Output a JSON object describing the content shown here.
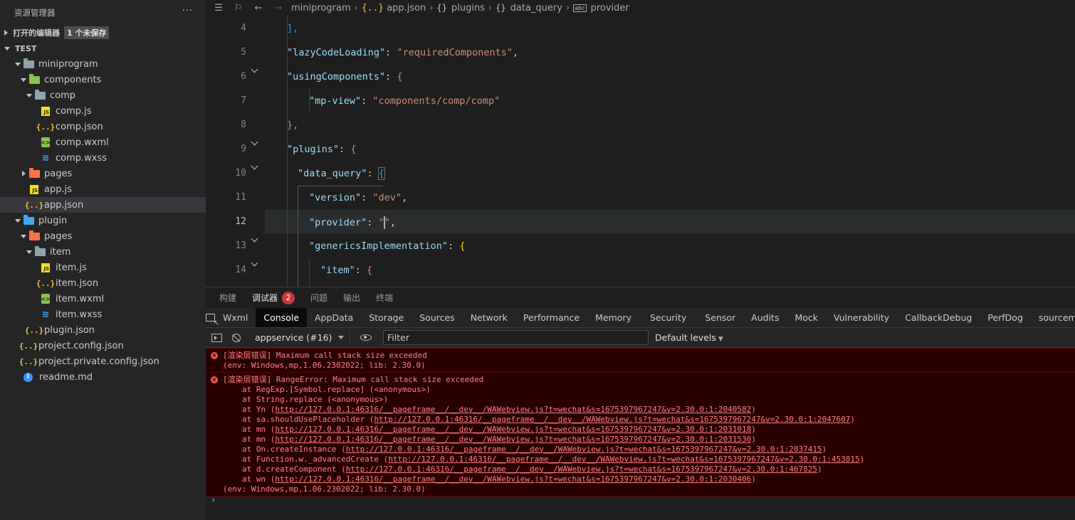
{
  "sidebar": {
    "title": "资源管理器",
    "more": "···",
    "open_editors": {
      "label": "打开的编辑器",
      "badge": "1 个未保存"
    },
    "workspace": "TEST",
    "tree": [
      {
        "label": "miniprogram",
        "depth": 0,
        "type": "folder",
        "icon": "folder-icon",
        "color": "gray",
        "open": true
      },
      {
        "label": "components",
        "depth": 1,
        "type": "folder",
        "icon": "components-folder-icon",
        "color": "green",
        "open": true
      },
      {
        "label": "comp",
        "depth": 2,
        "type": "folder",
        "icon": "folder-icon",
        "color": "gray",
        "open": true
      },
      {
        "label": "comp.js",
        "depth": 3,
        "type": "js"
      },
      {
        "label": "comp.json",
        "depth": 3,
        "type": "json"
      },
      {
        "label": "comp.wxml",
        "depth": 3,
        "type": "wxml"
      },
      {
        "label": "comp.wxss",
        "depth": 3,
        "type": "wxss"
      },
      {
        "label": "pages",
        "depth": 1,
        "type": "folder",
        "icon": "pages-folder-icon",
        "color": "orange",
        "open": false
      },
      {
        "label": "app.js",
        "depth": 1,
        "type": "js"
      },
      {
        "label": "app.json",
        "depth": 1,
        "type": "json",
        "selected": true
      },
      {
        "label": "plugin",
        "depth": 0,
        "type": "folder",
        "icon": "plugin-folder-icon",
        "color": "blue",
        "open": true
      },
      {
        "label": "pages",
        "depth": 1,
        "type": "folder",
        "icon": "pages-folder-icon",
        "color": "orange",
        "open": true
      },
      {
        "label": "item",
        "depth": 2,
        "type": "folder",
        "icon": "folder-icon",
        "color": "gray",
        "open": true
      },
      {
        "label": "item.js",
        "depth": 3,
        "type": "js"
      },
      {
        "label": "item.json",
        "depth": 3,
        "type": "json"
      },
      {
        "label": "item.wxml",
        "depth": 3,
        "type": "wxml"
      },
      {
        "label": "item.wxss",
        "depth": 3,
        "type": "wxss"
      },
      {
        "label": "plugin.json",
        "depth": 1,
        "type": "json"
      },
      {
        "label": "project.config.json",
        "depth": 0,
        "type": "json"
      },
      {
        "label": "project.private.config.json",
        "depth": 0,
        "type": "json"
      },
      {
        "label": "readme.md",
        "depth": 0,
        "type": "md"
      }
    ]
  },
  "editor": {
    "breadcrumb": {
      "folder": "miniprogram",
      "file_icon": "{..}",
      "file": "app.json",
      "obj_icon": "{}",
      "items": [
        "plugins",
        "data_query"
      ],
      "leaf_icon": "abc",
      "leaf": "provider"
    },
    "line_numbers": [
      "4",
      "5",
      "6",
      "7",
      "8",
      "9",
      "10",
      "11",
      "12",
      "13",
      "14"
    ],
    "current_line": "12",
    "code": {
      "l4": "],",
      "l5_key": "\"lazyCodeLoading\"",
      "l5_val": "\"requiredComponents\"",
      "l6_key": "\"usingComponents\"",
      "l7_key": "\"mp-view\"",
      "l7_val": "\"components/comp/comp\"",
      "l8": "},",
      "l9_key": "\"plugins\"",
      "l10_key": "\"data_query\"",
      "l11_key": "\"version\"",
      "l11_val": "\"dev\"",
      "l12_key": "\"provider\"",
      "l12_val_open": "\"",
      "l12_val_close": "\"",
      "l13_key": "\"genericsImplementation\"",
      "l14_key": "\"item\""
    }
  },
  "panel": {
    "tabs": [
      {
        "label": "构建",
        "active": false
      },
      {
        "label": "调试器",
        "active": true,
        "badge": "2"
      },
      {
        "label": "问题",
        "active": false
      },
      {
        "label": "输出",
        "active": false
      },
      {
        "label": "终端",
        "active": false
      }
    ],
    "devtools_tabs": [
      "Wxml",
      "Console",
      "AppData",
      "Storage",
      "Sources",
      "Network",
      "Performance",
      "Memory",
      "Security",
      "Sensor",
      "Audits",
      "Mock",
      "Vulnerability",
      "CallbackDebug",
      "PerfDog",
      "sourcemap"
    ],
    "devtools_active": "Console",
    "context": "appservice (#16)",
    "filter_placeholder": "Filter",
    "levels": "Default levels",
    "messages": [
      {
        "lines": [
          "[渲染层错误] Maximum call stack size exceeded",
          "(env: Windows,mp,1.06.2302022; lib: 2.30.0)"
        ]
      },
      {
        "title": "[渲染层错误] RangeError: Maximum call stack size exceeded",
        "stack": [
          {
            "pre": "at RegExp.[Symbol.replace] (<anonymous>)",
            "url": "",
            "post": ""
          },
          {
            "pre": "at String.replace (<anonymous>)",
            "url": "",
            "post": ""
          },
          {
            "pre": "at Yn (",
            "url": "http://127.0.0.1:46316/__pageframe__/__dev__/WAWebview.js?t=wechat&s=1675397967247&v=2.30.0:1:2040582",
            "post": ")"
          },
          {
            "pre": "at sa.shouldUsePlaceholder (",
            "url": "http://127.0.0.1:46316/__pageframe__/__dev__/WAWebview.js?t=wechat&s=1675397967247&v=2.30.0:1:2047607",
            "post": ")"
          },
          {
            "pre": "at mn (",
            "url": "http://127.0.0.1:46316/__pageframe__/__dev__/WAWebview.js?t=wechat&s=1675397967247&v=2.30.0:1:2031018",
            "post": ")"
          },
          {
            "pre": "at mn (",
            "url": "http://127.0.0.1:46316/__pageframe__/__dev__/WAWebview.js?t=wechat&s=1675397967247&v=2.30.0:1:2031530",
            "post": ")"
          },
          {
            "pre": "at On.createInstance (",
            "url": "http://127.0.0.1:46316/__pageframe__/__dev__/WAWebview.js?t=wechat&s=1675397967247&v=2.30.0:1:2037415",
            "post": ")"
          },
          {
            "pre": "at Function.w._advancedCreate (",
            "url": "http://127.0.0.1:46316/__pageframe__/__dev__/WAWebview.js?t=wechat&s=1675397967247&v=2.30.0:1:453815",
            "post": ")"
          },
          {
            "pre": "at d.createComponent (",
            "url": "http://127.0.0.1:46316/__pageframe__/__dev__/WAWebview.js?t=wechat&s=1675397967247&v=2.30.0:1:467825",
            "post": ")"
          },
          {
            "pre": "at wn (",
            "url": "http://127.0.0.1:46316/__pageframe__/__dev__/WAWebview.js?t=wechat&s=1675397967247&v=2.30.0:1:2030406",
            "post": ")"
          }
        ],
        "env": "(env: Windows,mp,1.06.2302022; lib: 2.30.0)"
      }
    ],
    "prompt": "›"
  },
  "colors": {
    "error_bg": "#290000",
    "error_text": "#ff8080",
    "accent": "#3794ff",
    "badge": "#c93737"
  }
}
